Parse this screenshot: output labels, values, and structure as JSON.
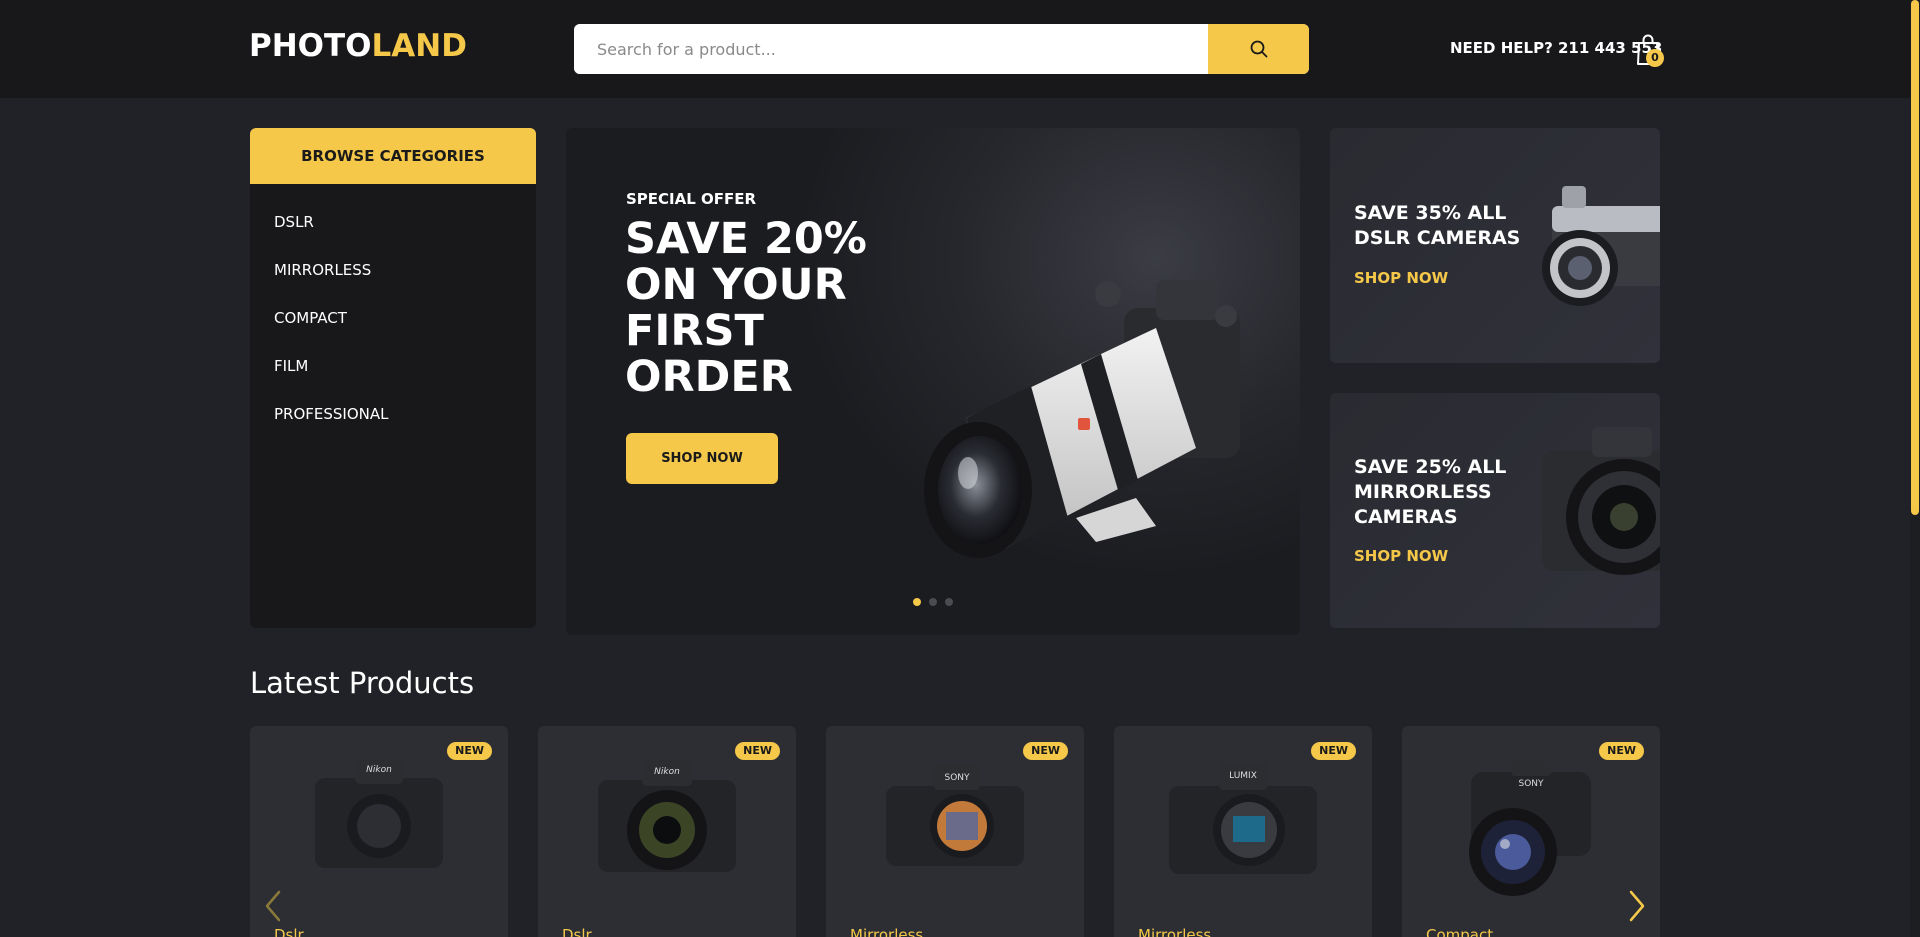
{
  "header": {
    "logo_part1": "PHOTO",
    "logo_part2": "LAND",
    "search_placeholder": "Search for a product...",
    "help_text": "NEED HELP? 211 443 553",
    "cart_count": "0"
  },
  "categories": {
    "title": "BROWSE CATEGORIES",
    "items": [
      "DSLR",
      "MIRRORLESS",
      "COMPACT",
      "FILM",
      "PROFESSIONAL"
    ]
  },
  "hero": {
    "subtitle": "SPECIAL OFFER",
    "title": "SAVE 20% ON YOUR FIRST ORDER",
    "button": "SHOP NOW",
    "slide_count": 3,
    "active_slide": 1
  },
  "promos": [
    {
      "title": "SAVE 35% ALL DSLR CAMERAS",
      "link": "SHOP NOW"
    },
    {
      "title": "SAVE 25% ALL MIRRORLESS CAMERAS",
      "link": "SHOP NOW"
    }
  ],
  "latest": {
    "title": "Latest Products",
    "products": [
      {
        "badge": "NEW",
        "type": "Dslr",
        "brand": "Nikon"
      },
      {
        "badge": "NEW",
        "type": "Dslr",
        "brand": "Nikon"
      },
      {
        "badge": "NEW",
        "type": "Mirrorless",
        "brand": "SONY"
      },
      {
        "badge": "NEW",
        "type": "Mirrorless",
        "brand": "LUMIX"
      },
      {
        "badge": "NEW",
        "type": "Compact",
        "brand": "SONY"
      }
    ]
  },
  "colors": {
    "accent": "#f5c84a",
    "header_bg": "#18181b",
    "page_bg": "#212227",
    "card_bg": "#2d2e34"
  }
}
